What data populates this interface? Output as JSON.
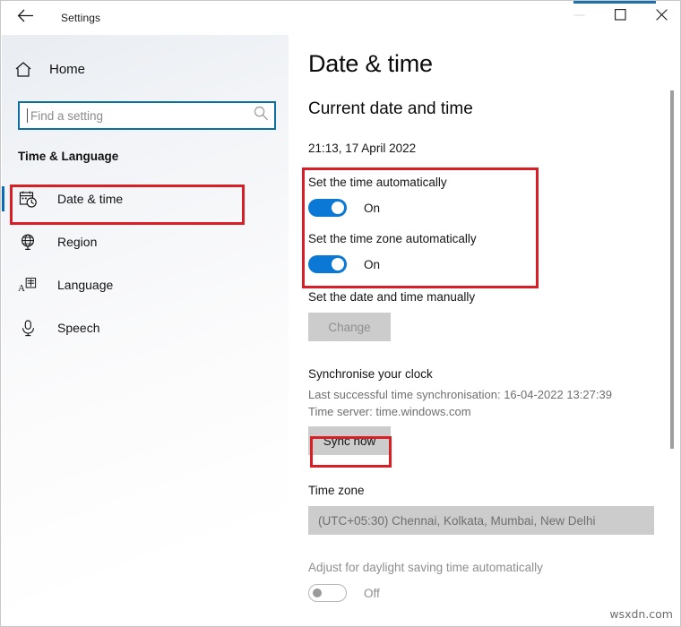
{
  "window": {
    "title": "Settings",
    "back_icon": "back-arrow-icon",
    "minimize_label": "─",
    "maximize_label": "□",
    "close_label": "✕",
    "accent_color": "#1f6fa8"
  },
  "sidebar": {
    "home_label": "Home",
    "home_icon": "home-icon",
    "search": {
      "placeholder": "Find a setting",
      "icon": "search-icon",
      "value": ""
    },
    "category_title": "Time & Language",
    "items": [
      {
        "label": "Date & time",
        "icon": "calendar-clock-icon",
        "active": true
      },
      {
        "label": "Region",
        "icon": "globe-icon",
        "active": false
      },
      {
        "label": "Language",
        "icon": "language-icon",
        "active": false
      },
      {
        "label": "Speech",
        "icon": "microphone-icon",
        "active": false
      }
    ]
  },
  "main": {
    "page_title": "Date & time",
    "current_section_title": "Current date and time",
    "current_datetime": "21:13, 17 April 2022",
    "auto_time": {
      "label": "Set the time automatically",
      "state_label": "On",
      "on": true
    },
    "auto_timezone": {
      "label": "Set the time zone automatically",
      "state_label": "On",
      "on": true
    },
    "manual": {
      "label": "Set the date and time manually",
      "change_button": "Change",
      "disabled": true
    },
    "sync": {
      "title": "Synchronise your clock",
      "last_sync": "Last successful time synchronisation: 16-04-2022 13:27:39",
      "time_server": "Time server: time.windows.com",
      "sync_button": "Sync now"
    },
    "timezone": {
      "title": "Time zone",
      "selected": "(UTC+05:30) Chennai, Kolkata, Mumbai, New Delhi"
    },
    "dst": {
      "label": "Adjust for daylight saving time automatically",
      "state_label": "Off",
      "on": false
    }
  },
  "annotations": {
    "highlight_color": "#d81f26",
    "boxes": [
      "sidebar-date-time-item",
      "auto-time-toggles-group",
      "sync-now-button"
    ]
  },
  "watermark": "wsxdn.com"
}
